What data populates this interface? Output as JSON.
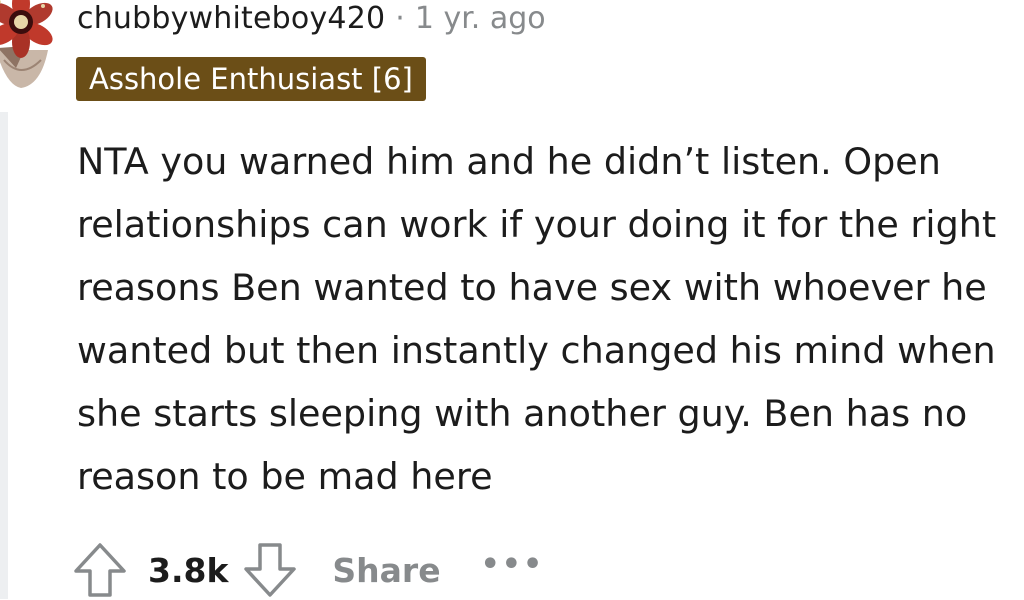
{
  "comment": {
    "author": "chubbywhiteboy420",
    "separator": "·",
    "timestamp": "1 yr. ago",
    "flair": "Asshole Enthusiast [6]",
    "body": "NTA you warned him and he didn’t listen. Open relationships can work if your doing it for the right reasons Ben wanted to have sex with whoever he wanted but then instantly changed his mind when she starts sleeping with another guy. Ben has no reason to be mad here",
    "avatar_icon": "demogorgon-avatar-icon",
    "flair_color": "#6b4e17"
  },
  "actions": {
    "upvote_icon": "upvote-arrow-icon",
    "score": "3.8k",
    "downvote_icon": "downvote-arrow-icon",
    "share_label": "Share",
    "more_label": "•••"
  }
}
